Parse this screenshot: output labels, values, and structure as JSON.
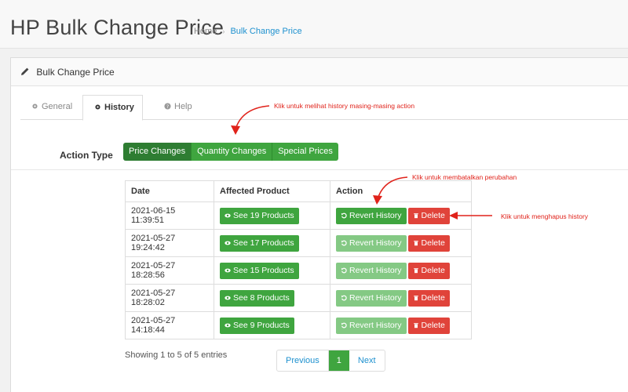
{
  "header": {
    "title": "HP Bulk Change Price",
    "breadcrumb": {
      "home": "Home",
      "separator": "›",
      "current": "Bulk Change Price"
    }
  },
  "panel": {
    "heading": "Bulk Change Price",
    "tabs": [
      {
        "label": "General",
        "icon": "gear-icon"
      },
      {
        "label": "History",
        "icon": "gear-icon",
        "active": true
      },
      {
        "label": "Help",
        "icon": "question-circle-icon"
      }
    ]
  },
  "action_type": {
    "label": "Action Type",
    "options": [
      "Price Changes",
      "Quantity Changes",
      "Special Prices"
    ],
    "selected": "Price Changes"
  },
  "table": {
    "columns": [
      "Date",
      "Affected Product",
      "Action"
    ],
    "rows": [
      {
        "date": "2021-06-15 11:39:51",
        "affected": "See 19 Products",
        "revert": "Revert History",
        "delete": "Delete",
        "revert_enabled": true
      },
      {
        "date": "2021-05-27 19:24:42",
        "affected": "See 17 Products",
        "revert": "Revert History",
        "delete": "Delete",
        "revert_enabled": false
      },
      {
        "date": "2021-05-27 18:28:56",
        "affected": "See 15 Products",
        "revert": "Revert History",
        "delete": "Delete",
        "revert_enabled": false
      },
      {
        "date": "2021-05-27 18:28:02",
        "affected": "See 8 Products",
        "revert": "Revert History",
        "delete": "Delete",
        "revert_enabled": false
      },
      {
        "date": "2021-05-27 14:18:44",
        "affected": "See 9 Products",
        "revert": "Revert History",
        "delete": "Delete",
        "revert_enabled": false
      }
    ]
  },
  "footer": {
    "entries_info": "Showing 1 to 5 of 5 entries",
    "pagination": {
      "previous": "Previous",
      "current": "1",
      "next": "Next"
    }
  },
  "annotations": {
    "history_tab": "Klik untuk melihat history masing-masing action",
    "revert": "Klik untuk membatalkan perubahan",
    "delete": "Klik untuk menghapus history"
  },
  "colors": {
    "primary_green": "#3fa53f",
    "active_green": "#2e7d32",
    "disabled_green": "#84c984",
    "danger_red": "#e0433a",
    "link_blue": "#1e91cf",
    "annotation_red": "#e0221a"
  }
}
